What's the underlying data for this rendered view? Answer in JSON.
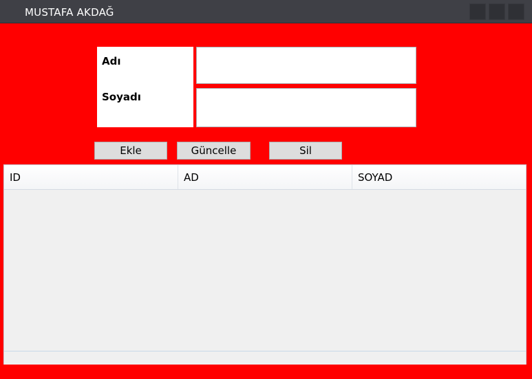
{
  "window": {
    "title": "MUSTAFA AKDAĞ",
    "background_color": "#ff0000"
  },
  "form": {
    "first_name_label": "Adı",
    "last_name_label": "Soyadı",
    "first_name_value": "",
    "last_name_value": ""
  },
  "buttons": {
    "add_label": "Ekle",
    "update_label": "Güncelle",
    "delete_label": "Sil"
  },
  "table": {
    "columns": [
      "ID",
      "AD",
      "SOYAD"
    ],
    "rows": []
  }
}
